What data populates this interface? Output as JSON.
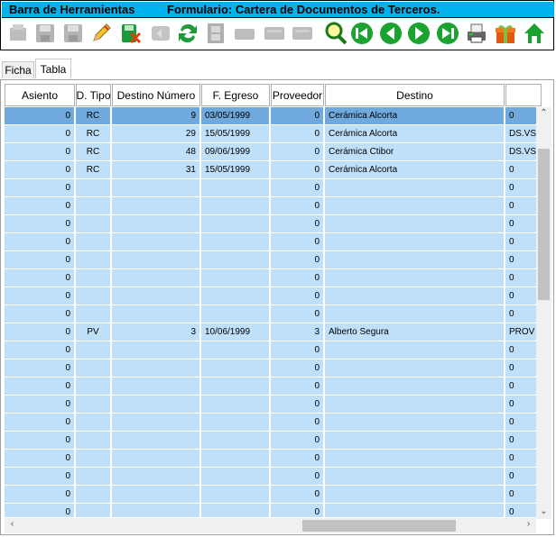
{
  "window": {
    "toolbar_title": "Barra de Herramientas",
    "form_title": "Formulario: Cartera de Documentos de Terceros."
  },
  "toolbar": {
    "buttons": [
      {
        "icon": "new-record-icon",
        "enabled": false
      },
      {
        "icon": "save-icon",
        "enabled": false
      },
      {
        "icon": "save-all-icon",
        "enabled": false
      },
      {
        "icon": "edit-pencil-icon",
        "enabled": true
      },
      {
        "icon": "delete-record-icon",
        "enabled": true
      },
      {
        "icon": "undo-icon",
        "enabled": false
      },
      {
        "icon": "refresh-icon",
        "enabled": true
      },
      {
        "icon": "filmstrip-icon",
        "enabled": false
      },
      {
        "icon": "disabled-button-1-icon",
        "enabled": false
      },
      {
        "icon": "disabled-button-2-icon",
        "enabled": false
      },
      {
        "icon": "disabled-button-3-icon",
        "enabled": false
      },
      {
        "icon": "search-icon",
        "enabled": true
      },
      {
        "icon": "first-record-icon",
        "enabled": true
      },
      {
        "icon": "previous-record-icon",
        "enabled": true
      },
      {
        "icon": "next-record-icon",
        "enabled": true
      },
      {
        "icon": "last-record-icon",
        "enabled": true
      },
      {
        "icon": "printer-icon",
        "enabled": true
      },
      {
        "icon": "gift-icon",
        "enabled": true
      },
      {
        "icon": "home-icon",
        "enabled": true
      }
    ]
  },
  "tabs": {
    "ficha": "Ficha",
    "tabla": "Tabla",
    "active": "Tabla"
  },
  "grid": {
    "columns": [
      "Asiento",
      "D. Tipo",
      "Destino Número",
      "F. Egreso",
      "Proveedor",
      "Destino",
      ""
    ],
    "rows": [
      [
        "0",
        "RC",
        "9",
        "03/05/1999",
        "0",
        "Cerámica Alcorta",
        "0"
      ],
      [
        "0",
        "RC",
        "29",
        "15/05/1999",
        "0",
        "Cerámica Alcorta",
        "DS.VS"
      ],
      [
        "0",
        "RC",
        "48",
        "09/06/1999",
        "0",
        "Cerámica Ctibor",
        "DS.VS"
      ],
      [
        "0",
        "RC",
        "31",
        "15/05/1999",
        "0",
        "Cerámica Alcorta",
        "0"
      ],
      [
        "0",
        "",
        "",
        "",
        "0",
        "",
        "0"
      ],
      [
        "0",
        "",
        "",
        "",
        "0",
        "",
        "0"
      ],
      [
        "0",
        "",
        "",
        "",
        "0",
        "",
        "0"
      ],
      [
        "0",
        "",
        "",
        "",
        "0",
        "",
        "0"
      ],
      [
        "0",
        "",
        "",
        "",
        "0",
        "",
        "0"
      ],
      [
        "0",
        "",
        "",
        "",
        "0",
        "",
        "0"
      ],
      [
        "0",
        "",
        "",
        "",
        "0",
        "",
        "0"
      ],
      [
        "0",
        "",
        "",
        "",
        "0",
        "",
        "0"
      ],
      [
        "0",
        "PV",
        "3",
        "10/06/1999",
        "3",
        "Alberto Segura",
        "PROV"
      ],
      [
        "0",
        "",
        "",
        "",
        "0",
        "",
        "0"
      ],
      [
        "0",
        "",
        "",
        "",
        "0",
        "",
        "0"
      ],
      [
        "0",
        "",
        "",
        "",
        "0",
        "",
        "0"
      ],
      [
        "0",
        "",
        "",
        "",
        "0",
        "",
        "0"
      ],
      [
        "0",
        "",
        "",
        "",
        "0",
        "",
        "0"
      ],
      [
        "0",
        "",
        "",
        "",
        "0",
        "",
        "0"
      ],
      [
        "0",
        "",
        "",
        "",
        "0",
        "",
        "0"
      ],
      [
        "0",
        "",
        "",
        "",
        "0",
        "",
        "0"
      ],
      [
        "0",
        "",
        "",
        "",
        "0",
        "",
        "0"
      ],
      [
        "0",
        "",
        "",
        "",
        "0",
        "",
        "0"
      ]
    ],
    "selected_row": 0
  },
  "colors": {
    "titlebar": "#00b2ee",
    "row": "#bfe0f8",
    "row_selected": "#6fa9dd"
  }
}
